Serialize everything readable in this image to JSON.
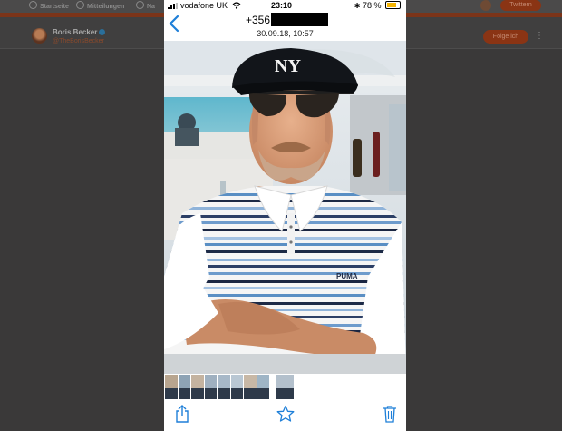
{
  "background": {
    "nav": {
      "home": "Startseite",
      "notifications": "Mitteilungen",
      "messages": "Na"
    },
    "tweet_button": "Twittern",
    "profile": {
      "name": "Boris Becker",
      "handle": "@TheBorisBecker",
      "follow_button": "Folge ich"
    }
  },
  "status_bar": {
    "carrier": "vodafone UK",
    "time": "23:10",
    "battery_percent": "78 %",
    "battery_level": 0.78
  },
  "header": {
    "contact_prefix": "+356",
    "timestamp": "30.09.18, 10:57"
  },
  "photo": {
    "cap_logo": "NY",
    "shirt_logo": "PUMA"
  },
  "thumbnails_count": 9,
  "colors": {
    "accent": "#1e7fd8",
    "twitter_orange": "#8a3414",
    "battery": "#f5b400"
  },
  "icons": {
    "back": "chevron-left-icon",
    "share": "share-icon",
    "favorite": "star-icon",
    "delete": "trash-icon"
  }
}
